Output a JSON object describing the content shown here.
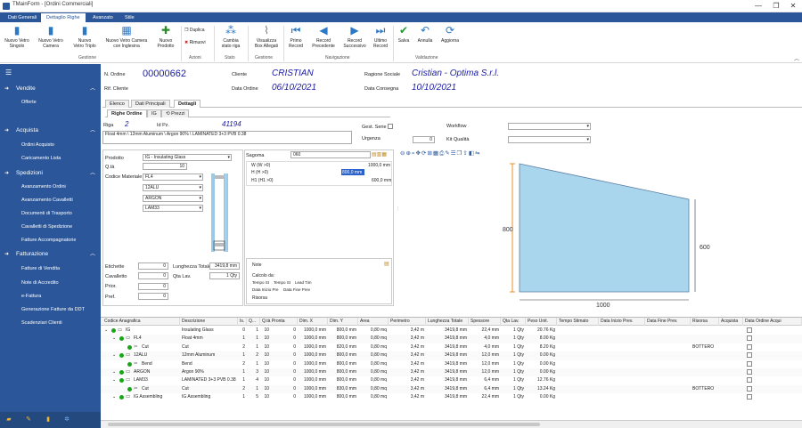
{
  "window": {
    "title": "TMainForm - [Ordini Commerciali]",
    "min": "—",
    "max": "❐",
    "close": "✕"
  },
  "menu": [
    "Dati Generali",
    "Dettaglio Righe",
    "Avanzato",
    "Stile"
  ],
  "ribbon": {
    "groups": [
      {
        "label": "Gestione",
        "buttons": [
          "Nuovo Vetro\nSingolo",
          "Nuovo Vetro\nCamera",
          "Nuovo\nVetro Triplo",
          "Nuovo Vetro Camera\ncon Inglesina",
          "Nuovo\nProdotto"
        ]
      },
      {
        "label": "Azioni",
        "buttons": [
          "Duplica",
          "Rimuovi"
        ]
      },
      {
        "label": "Stato",
        "buttons": [
          "Cambia\nstato riga"
        ]
      },
      {
        "label": "Gestione",
        "buttons": [
          "Visualizza\nBox Allegati"
        ]
      },
      {
        "label": "Navigazione",
        "buttons": [
          "Primo\nRecord",
          "Record\nPrecedente",
          "Record\nSuccessivo",
          "Ultimo\nRecord"
        ]
      },
      {
        "label": "Validazione",
        "buttons": [
          "Salva",
          "Annulla",
          "Aggiorna"
        ]
      }
    ]
  },
  "sidebar": {
    "sections": [
      {
        "title": "Vendite",
        "items": [
          "Offerte",
          "Ordini Commerciali"
        ]
      },
      {
        "title": "Acquista",
        "items": [
          "Ordini Acquisto",
          "Caricamento Lista"
        ]
      },
      {
        "title": "Spedizioni",
        "items": [
          "Avanzamento Ordini",
          "Avanzamento Cavalletti",
          "Documenti di Trasporto",
          "Cavalletti di Spedizione",
          "Fatture Accompagnatorie"
        ]
      },
      {
        "title": "Fatturazione",
        "items": [
          "Fatture di Vendita",
          "Note di Accredito",
          "e-Fattura",
          "Generazione Fatture da DDT",
          "Scadenziari Clienti"
        ]
      }
    ]
  },
  "header": {
    "n_ordine_label": "N. Ordine",
    "n_ordine": "00000662",
    "cliente_label": "Cliente",
    "cliente": "CRISTIAN",
    "ragione_label": "Ragione Sociale",
    "ragione": "Cristian - Optima S.r.l.",
    "rif_label": "Rif. Cliente",
    "data_ordine_label": "Data Ordine",
    "data_ordine": "06/10/2021",
    "data_consegna_label": "Data Consegna",
    "data_consegna": "10/10/2021"
  },
  "tabs": [
    "Elenco",
    "Dati Principali",
    "Dettagli"
  ],
  "subtabs": [
    "Righe Ordine",
    "IG",
    "Prezzi"
  ],
  "riga": {
    "riga_label": "Riga",
    "riga": "2",
    "idpz_label": "Id Pz.",
    "idpz": "41194",
    "description": "Float 4mm \\ 12mm Aluminum \\ Argon 90% \\ LAMINATED 3+3 PVB 0.38",
    "gest_serie": "Gest. Serie",
    "urgenza": "Urgenza",
    "urgenza_val": "0",
    "workflow": "Workflow",
    "kit_qualita": "Kit Qualità"
  },
  "prod": {
    "prodotto_label": "Prodotto",
    "prodotto": "IG - Insulating Glass",
    "qta_label": "Q.tà",
    "qta": "10",
    "codmat_label": "Codice Materiale",
    "materials": [
      "FL4",
      "12ALU",
      "ARGON",
      "LAM33"
    ],
    "etichette": "Etichette",
    "etichette_val": "0",
    "lungh_label": "Lunghezza Totale",
    "lungh": "3419,8 mm",
    "cavalletto": "Cavalletto",
    "cavalletto_val": "0",
    "qtalav_label": "Qta Lav.",
    "qtalav": "1 Qty",
    "prior": "Prior.",
    "prior_val": "0",
    "pref": "Pref.",
    "pref_val": "0"
  },
  "sagoma": {
    "label": "Sagoma",
    "value": "060",
    "params": [
      [
        "W (W >0)",
        "1000,0 mm"
      ],
      [
        "H (H >0)",
        "800,0 mm"
      ],
      [
        "H1 (H1 >0)",
        "600,0 mm"
      ]
    ],
    "note": "Note",
    "calcolo": "Calcolo da:",
    "tempo_st": "Tempo St",
    "tempo_st2": "Tempo St",
    "lead_time": "Lead Tim",
    "data_inizio": "Data Inizio Pre",
    "data_fine": "Data Fine Prev",
    "risorsa": "Risorsa"
  },
  "shape": {
    "w_label": "1000",
    "h_label": "800",
    "h1_label": "600",
    "fill": "#a9d6ec",
    "stroke": "#5b7fa6",
    "dim_color": "#e8912a"
  },
  "table": {
    "headers": [
      "Codice Anagrafica",
      "Descrizione",
      "Is.",
      "Q...",
      "Q.tà Pronta",
      "Dim. X",
      "Dim. Y",
      "Area",
      "Perimetro",
      "Lunghezza Totale",
      "Spessore",
      "Qta Lav.",
      "Peso Unit.",
      "Tempo Stimato",
      "Data Inizio Prev.",
      "Data Fine Prev.",
      "Risorsa",
      "Acquista",
      "Data Ordine Acqui"
    ],
    "rows": [
      {
        "ind": 0,
        "code": "IG",
        "desc": "Insulating Glass",
        "is": "0",
        "q": "1",
        "qp": "10",
        "dx": "0",
        "x": "1000,0 mm",
        "y": "800,0 mm",
        "area": "0,80 mq",
        "per": "3,42 m",
        "lt": "3419,8 mm",
        "sp": "22,4 mm",
        "ql": "1 Qty",
        "pu": "20.76 Kg",
        "ris": ""
      },
      {
        "ind": 1,
        "code": "FL4",
        "desc": "Float 4mm",
        "is": "1",
        "q": "1",
        "qp": "10",
        "dx": "0",
        "x": "1000,0 mm",
        "y": "800,0 mm",
        "area": "0,80 mq",
        "per": "3,42 m",
        "lt": "3419,8 mm",
        "sp": "4,0 mm",
        "ql": "1 Qty",
        "pu": "8.00 Kg",
        "ris": ""
      },
      {
        "ind": 2,
        "code": "Cut",
        "desc": "Cut",
        "is": "2",
        "q": "1",
        "qp": "10",
        "dx": "0",
        "x": "1000,0 mm",
        "y": "820,0 mm",
        "area": "0,80 mq",
        "per": "3,42 m",
        "lt": "3419,8 mm",
        "sp": "4,0 mm",
        "ql": "1 Qty",
        "pu": "8.20 Kg",
        "ris": "BOTTERO"
      },
      {
        "ind": 1,
        "code": "12ALU",
        "desc": "12mm Aluminum",
        "is": "1",
        "q": "2",
        "qp": "10",
        "dx": "0",
        "x": "1000,0 mm",
        "y": "800,0 mm",
        "area": "0,80 mq",
        "per": "3,42 m",
        "lt": "3419,8 mm",
        "sp": "12,0 mm",
        "ql": "1 Qty",
        "pu": "0.00 Kg",
        "ris": ""
      },
      {
        "ind": 2,
        "code": "Bend",
        "desc": "Bend",
        "is": "2",
        "q": "1",
        "qp": "10",
        "dx": "0",
        "x": "1000,0 mm",
        "y": "800,0 mm",
        "area": "0,80 mq",
        "per": "3,42 m",
        "lt": "3419,8 mm",
        "sp": "12,0 mm",
        "ql": "1 Qty",
        "pu": "0.00 Kg",
        "ris": ""
      },
      {
        "ind": 1,
        "code": "ARGON",
        "desc": "Argon 90%",
        "is": "1",
        "q": "3",
        "qp": "10",
        "dx": "0",
        "x": "1000,0 mm",
        "y": "800,0 mm",
        "area": "0,80 mq",
        "per": "3,42 m",
        "lt": "3419,8 mm",
        "sp": "12,0 mm",
        "ql": "1 Qty",
        "pu": "0.00 Kg",
        "ris": ""
      },
      {
        "ind": 1,
        "code": "LAM33",
        "desc": "LAMINATED 3+3 PVB 0.38",
        "is": "1",
        "q": "4",
        "qp": "10",
        "dx": "0",
        "x": "1000,0 mm",
        "y": "800,0 mm",
        "area": "0,80 mq",
        "per": "3,42 m",
        "lt": "3419,8 mm",
        "sp": "6,4 mm",
        "ql": "1 Qty",
        "pu": "12.76 Kg",
        "ris": ""
      },
      {
        "ind": 2,
        "code": "Cut",
        "desc": "Cut",
        "is": "2",
        "q": "1",
        "qp": "10",
        "dx": "0",
        "x": "1000,0 mm",
        "y": "830,0 mm",
        "area": "0,80 mq",
        "per": "3,42 m",
        "lt": "3419,8 mm",
        "sp": "6,4 mm",
        "ql": "1 Qty",
        "pu": "13.24 Kg",
        "ris": "BOTTERO"
      },
      {
        "ind": 1,
        "code": "IG Assembling",
        "desc": "IG Assembling",
        "is": "1",
        "q": "5",
        "qp": "10",
        "dx": "0",
        "x": "1000,0 mm",
        "y": "800,0 mm",
        "area": "0,80 mq",
        "per": "3,42 m",
        "lt": "3419,8 mm",
        "sp": "22,4 mm",
        "ql": "1 Qty",
        "pu": "0.00 Kg",
        "ris": ""
      }
    ]
  }
}
